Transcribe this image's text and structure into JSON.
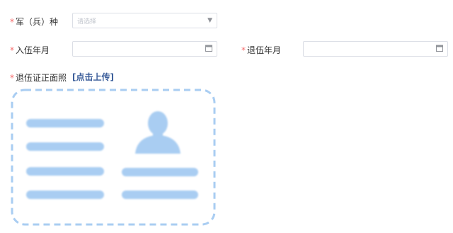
{
  "form": {
    "service_branch": {
      "label": "军（兵）种",
      "placeholder": "请选择",
      "required": true
    },
    "enlist_date": {
      "label": "入伍年月",
      "value": "",
      "required": true
    },
    "discharge_date": {
      "label": "退伍年月",
      "value": "",
      "required": true
    },
    "discharge_cert": {
      "label": "退伍证正面照",
      "upload_text": "[点击上传]",
      "required": true
    }
  },
  "required_mark": "*",
  "colors": {
    "required": "#f56c6c",
    "link": "#3a5d9a",
    "border": "#dcdfe6",
    "placeholder_illustration": "#a9cdf2"
  },
  "icons": [
    "chevron-down-icon",
    "calendar-icon",
    "id-card-placeholder-icon"
  ]
}
